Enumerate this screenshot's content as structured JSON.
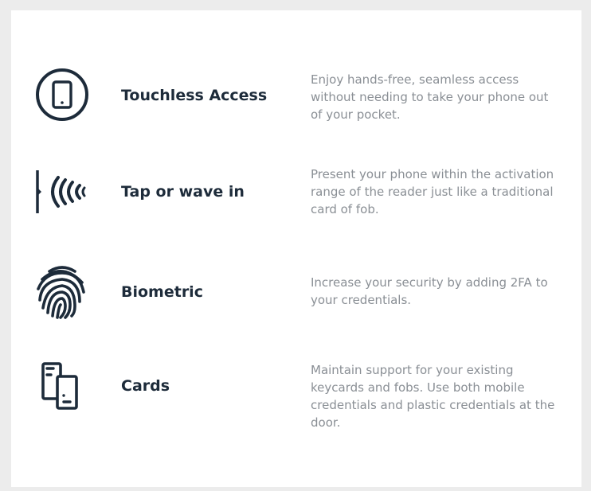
{
  "features": [
    {
      "icon": "smartphone-icon",
      "title": "Touchless Access",
      "description": "Enjoy hands-free, seamless access without needing to take your phone out of your pocket."
    },
    {
      "icon": "contactless-wave-icon",
      "title": "Tap or wave in",
      "description": "Present your phone within the activation range of the reader just like a traditional card of fob."
    },
    {
      "icon": "fingerprint-icon",
      "title": "Biometric",
      "description": "Increase your security by adding 2FA to your credentials."
    },
    {
      "icon": "cards-icon",
      "title": "Cards",
      "description": "Maintain support for your existing keycards and fobs. Use both mobile credentials and plastic credentials at the door."
    }
  ],
  "colors": {
    "icon": "#1d2b3a",
    "title": "#1d2b3a",
    "description": "#8a8f95",
    "background": "#ececec",
    "panel": "#ffffff"
  }
}
